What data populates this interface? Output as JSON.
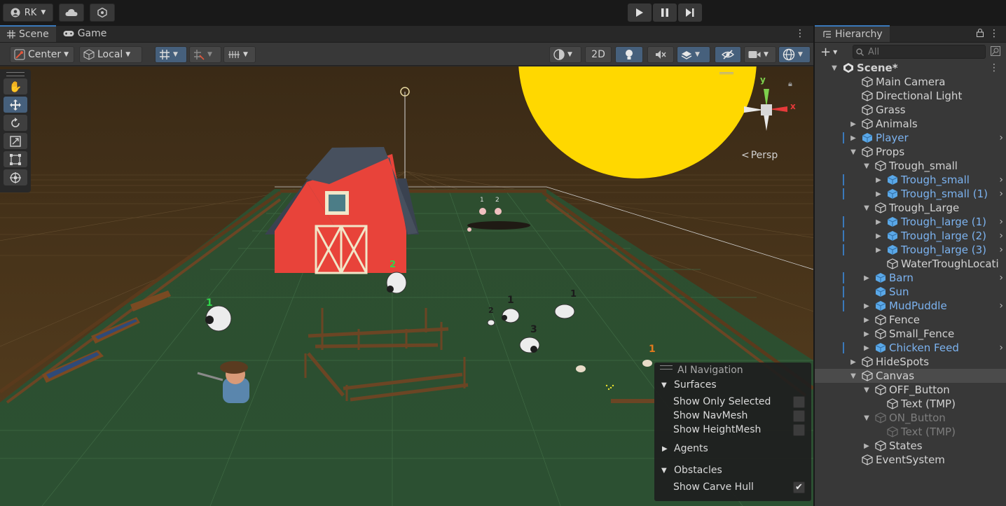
{
  "topbar": {
    "account_label": "RK",
    "account_icon": "account-icon",
    "cloud_icon": "cloud-icon",
    "collab_icon": "collab-icon",
    "play_icon": "play-icon",
    "pause_icon": "pause-icon",
    "step_icon": "step-icon"
  },
  "scene": {
    "tabs": [
      {
        "label": "Scene",
        "icon": "grid-icon"
      },
      {
        "label": "Game",
        "icon": "gamepad-icon"
      }
    ],
    "toolbar": {
      "pivot_label": "Center",
      "space_label": "Local",
      "mode_2d_label": "2D",
      "persp_label": "Persp"
    },
    "gizmo_axes": {
      "y": "y",
      "x": "x"
    },
    "agent_labels": [
      "1",
      "2",
      "1",
      "2",
      "1",
      "1",
      "3",
      "1",
      "2"
    ],
    "ai_navigation": {
      "title": "AI Navigation",
      "surfaces_label": "Surfaces",
      "show_only_selected": "Show Only Selected",
      "show_navmesh": "Show NavMesh",
      "show_heightmesh": "Show HeightMesh",
      "agents_label": "Agents",
      "obstacles_label": "Obstacles",
      "show_carve_hull": "Show Carve Hull",
      "checks": {
        "only_selected": false,
        "navmesh": false,
        "heightmesh": false,
        "carve_hull": true
      }
    }
  },
  "hierarchy": {
    "tab_label": "Hierarchy",
    "search_placeholder": "All",
    "items": [
      {
        "label": "Scene*",
        "depth": 0,
        "arrow": "down",
        "kind": "scene"
      },
      {
        "label": "Main Camera",
        "depth": 1,
        "arrow": "",
        "kind": "obj"
      },
      {
        "label": "Directional Light",
        "depth": 1,
        "arrow": "",
        "kind": "obj"
      },
      {
        "label": "Grass",
        "depth": 1,
        "arrow": "",
        "kind": "obj"
      },
      {
        "label": "Animals",
        "depth": 1,
        "arrow": "right",
        "kind": "obj"
      },
      {
        "label": "Player",
        "depth": 1,
        "arrow": "right",
        "kind": "prefab"
      },
      {
        "label": "Props",
        "depth": 1,
        "arrow": "down",
        "kind": "obj"
      },
      {
        "label": "Trough_small",
        "depth": 2,
        "arrow": "down",
        "kind": "obj"
      },
      {
        "label": "Trough_small",
        "depth": 3,
        "arrow": "right",
        "kind": "prefab"
      },
      {
        "label": "Trough_small (1)",
        "depth": 3,
        "arrow": "right",
        "kind": "prefab"
      },
      {
        "label": "Trough_Large",
        "depth": 2,
        "arrow": "down",
        "kind": "obj"
      },
      {
        "label": "Trough_large (1)",
        "depth": 3,
        "arrow": "right",
        "kind": "prefab"
      },
      {
        "label": "Trough_large (2)",
        "depth": 3,
        "arrow": "right",
        "kind": "prefab"
      },
      {
        "label": "Trough_large (3)",
        "depth": 3,
        "arrow": "right",
        "kind": "prefab"
      },
      {
        "label": "WaterTroughLocati",
        "depth": 3,
        "arrow": "",
        "kind": "obj"
      },
      {
        "label": "Barn",
        "depth": 2,
        "arrow": "right",
        "kind": "prefab"
      },
      {
        "label": "Sun",
        "depth": 2,
        "arrow": "",
        "kind": "prefab"
      },
      {
        "label": "MudPuddle",
        "depth": 2,
        "arrow": "right",
        "kind": "prefab"
      },
      {
        "label": "Fence",
        "depth": 2,
        "arrow": "right",
        "kind": "obj"
      },
      {
        "label": "Small_Fence",
        "depth": 2,
        "arrow": "right",
        "kind": "obj"
      },
      {
        "label": "Chicken Feed",
        "depth": 2,
        "arrow": "right",
        "kind": "prefab"
      },
      {
        "label": "HideSpots",
        "depth": 1,
        "arrow": "right",
        "kind": "obj"
      },
      {
        "label": "Canvas",
        "depth": 1,
        "arrow": "down",
        "kind": "obj",
        "selected": true
      },
      {
        "label": "OFF_Button",
        "depth": 2,
        "arrow": "down",
        "kind": "obj"
      },
      {
        "label": "Text (TMP)",
        "depth": 3,
        "arrow": "",
        "kind": "obj"
      },
      {
        "label": "ON_Button",
        "depth": 2,
        "arrow": "down",
        "kind": "dim"
      },
      {
        "label": "Text (TMP)",
        "depth": 3,
        "arrow": "",
        "kind": "dim"
      },
      {
        "label": "States",
        "depth": 2,
        "arrow": "right",
        "kind": "obj"
      },
      {
        "label": "EventSystem",
        "depth": 1,
        "arrow": "",
        "kind": "obj"
      }
    ]
  }
}
